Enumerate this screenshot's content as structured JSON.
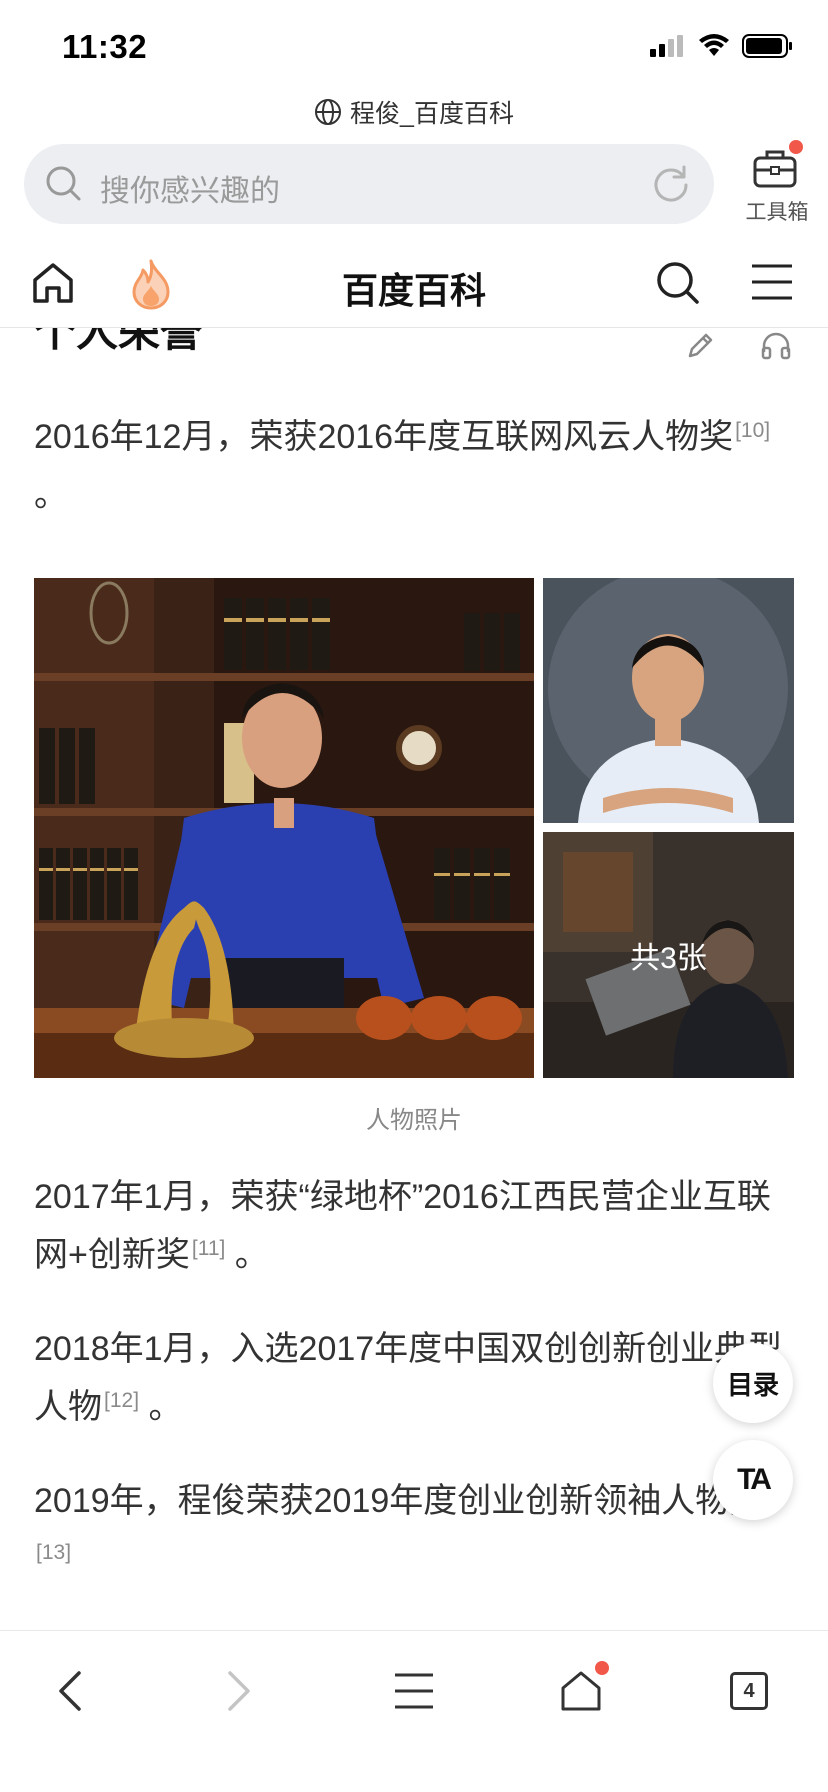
{
  "status": {
    "time": "11:32"
  },
  "url_bar": {
    "title": "程俊_百度百科"
  },
  "search": {
    "placeholder": "搜你感兴趣的"
  },
  "toolbox": {
    "label": "工具箱"
  },
  "nav": {
    "title": "百度百科"
  },
  "section": {
    "title": "个人荣誉"
  },
  "paragraphs": [
    {
      "text": "2016年12月，荣获2016年度互联网风云人物奖",
      "ref": "[10]",
      "tail": " 。"
    },
    {
      "text": "2017年1月，荣获“绿地杯”2016江西民营企业互联网+创新奖",
      "ref": "[11]",
      "tail": " 。"
    },
    {
      "text": "2018年1月，入选2017年度中国双创创新创业典型人物",
      "ref": "[12]",
      "tail": " 。"
    },
    {
      "text": "2019年，程俊荣获2019年度创业创新领袖人物奖",
      "ref": "[13]",
      "tail": ""
    }
  ],
  "gallery": {
    "count_label": "共3张",
    "caption": "人物照片"
  },
  "floating": {
    "toc_label": "目录",
    "ta_label": "TA"
  },
  "bottom_bar": {
    "tab_count": "4"
  },
  "colors": {
    "accent_red": "#f2584a",
    "fire_orange": "#f7a36b",
    "shirt_blue": "#2a3fb0"
  }
}
